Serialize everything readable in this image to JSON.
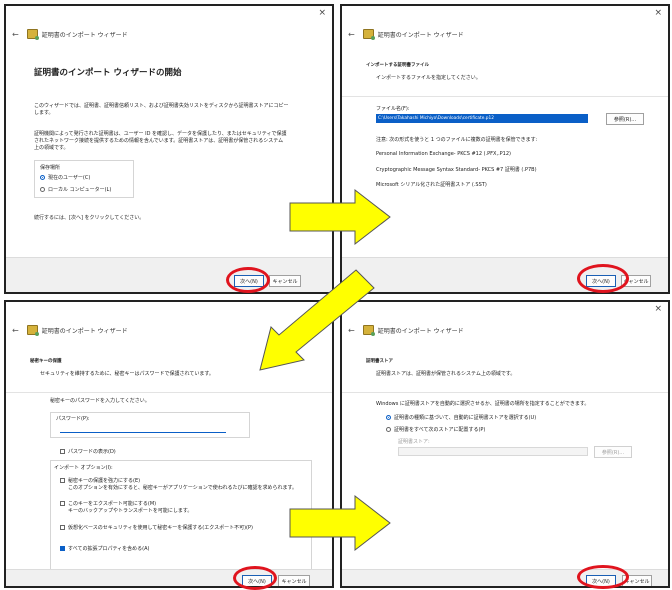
{
  "wizard_title": "証明書のインポート ウィザード",
  "close_glyph": "×",
  "back_glyph": "←",
  "buttons": {
    "next": "次へ(N)",
    "cancel": "キャンセル",
    "browse": "参照(R)..."
  },
  "panel1": {
    "heading": "証明書のインポート ウィザードの開始",
    "desc1a": "このウィザードでは、証明書、証明書信頼リスト、および証明書失効リストをディスクから証明書ストアにコピー",
    "desc1b": "します。",
    "desc2a": "証明機関によって発行された証明書は、ユーザー ID を確認し、データを保護したり、またはセキュリティで保護",
    "desc2b": "されたネットワーク接続を提供するための情報を含んでいます。証明書ストアは、証明書が保管されるシステム",
    "desc2c": "上の領域です。",
    "location_label": "保存場所",
    "opt_current_user": "現在のユーザー(C)",
    "opt_local_machine": "ローカル コンピューター(L)",
    "continue": "続行するには、[次へ] をクリックしてください。"
  },
  "panel2": {
    "section": "インポートする証明書ファイル",
    "sub": "インポートするファイルを指定してください。",
    "file_label": "ファイル名(F):",
    "file_value": "C:\\Users\\Takahashi Michiyo\\Downloads\\certificate.p12",
    "note": "注意: 次の形式を使うと 1 つのファイルに複数の証明書を保管できます:",
    "format1": "Personal Information Exchange- PKCS #12 (.PFX,.P12)",
    "format2": "Cryptographic Message Syntax Standard- PKCS #7 証明書 (.P7B)",
    "format3": "Microsoft シリアル化された証明書ストア (.SST)"
  },
  "panel3": {
    "section": "秘密キーの保護",
    "sub": "セキュリティを維持するために、秘密キーはパスワードで保護されています。",
    "enter": "秘密キーのパスワードを入力してください。",
    "password_label": "パスワード(P):",
    "show_password": "パスワードの表示(D)",
    "options_label": "インポート オプション(I):",
    "opt1a": "秘密キーの保護を強力にする(E)",
    "opt1b": "このオプションを有効にすると、秘密キーがアプリケーションで使われるたびに確認を求められます。",
    "opt2a": "このキーをエクスポート可能にする(M)",
    "opt2b": "キーのバックアップやトランスポートを可能にします。",
    "opt3": "仮想化ベースのセキュリティを使用して秘密キーを保護する(エクスポート不可)(P)",
    "opt4": "すべての拡張プロパティを含める(A)"
  },
  "panel4": {
    "section": "証明書ストア",
    "sub": "証明書ストアは、証明書が保管されるシステム上の領域です。",
    "desc": "Windows に証明書ストアを自動的に選択させるか、証明書の場所を指定することができます。",
    "opt_auto": "証明書の種類に基づいて、自動的に証明書ストアを選択する(U)",
    "opt_manual": "証明書をすべて次のストアに配置する(P)",
    "store_label": "証明書ストア:"
  },
  "colors": {
    "arrow_fill": "#ffff00",
    "arrow_stroke": "#555555",
    "highlight": "#e0141e",
    "selection": "#0a5fc7"
  }
}
